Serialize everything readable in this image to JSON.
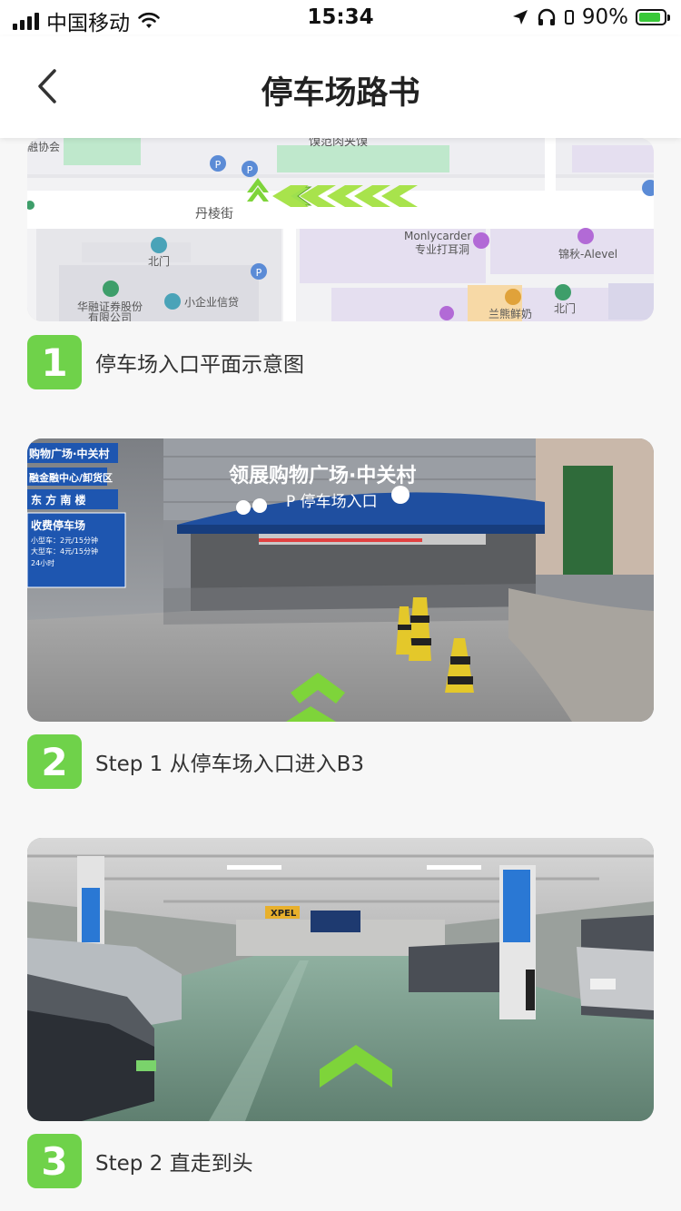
{
  "status": {
    "carrier": "中国移动",
    "time": "15:34",
    "battery": "90%",
    "battery_level": 0.9
  },
  "header": {
    "title": "停车场路书"
  },
  "map": {
    "labels": {
      "poi_top": "馍范肉夹馍",
      "poi_topleft": "融协会",
      "street": "丹棱街",
      "gate_left": "北门",
      "shop1": "Monlycarder",
      "shop1b": "专业打耳洞",
      "shop2": "锦秋-Alevel",
      "company1": "华融证券股份",
      "company1b": "有限公司",
      "company2": "小企业信贷",
      "gate_right": "北门",
      "shop3": "兰熊鲜奶"
    }
  },
  "steps": [
    {
      "number": "1",
      "label": "停车场入口平面示意图"
    },
    {
      "number": "2",
      "label": "Step 1 从停车场入口进入B3"
    },
    {
      "number": "3",
      "label": "Step 2 直走到头"
    }
  ],
  "photo2": {
    "mall_sign": "领展购物广场·中关村",
    "entrance_sign": "P 停车场入口",
    "dir1": "购物广场·中关村",
    "dir2": "融金融中心/卸货区",
    "dir3": "东 方 南 楼",
    "fee_title": "收费停车场",
    "fee_small": "小型车：2元/15分钟",
    "fee_large": "大型车：4元/15分钟",
    "fee_hours": "24小时"
  },
  "photo3": {
    "sign": "XPEL"
  }
}
